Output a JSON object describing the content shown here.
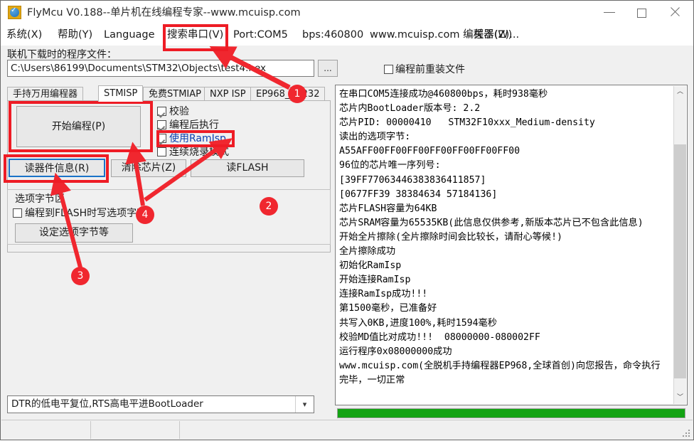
{
  "window": {
    "title": "FlyMcu V0.188--单片机在线编程专家--www.mcuisp.com",
    "icon": "app-icon",
    "minimize": "–",
    "maximize": "□",
    "close": "✕"
  },
  "menu": {
    "items": [
      {
        "text": "系统(X)",
        "name": "menu-system"
      },
      {
        "text": "帮助(Y)",
        "name": "menu-help"
      },
      {
        "text": "Language",
        "name": "menu-language"
      },
      {
        "text": "搜索串口(V)",
        "name": "menu-search-port"
      },
      {
        "text": "Port:COM5",
        "name": "menu-port"
      },
      {
        "text": "bps:460800",
        "name": "menu-bps"
      },
      {
        "text": "www.mcuisp.com 编程器(W)",
        "name": "menu-programmer"
      },
      {
        "text": "关于(Z)...",
        "name": "menu-about"
      }
    ]
  },
  "file": {
    "label": "联机下载时的程序文件：",
    "path": "C:\\Users\\86199\\Documents\\STM32\\Objects\\test4.hex",
    "browse_label": "...",
    "reload_checkbox": {
      "label": "编程前重装文件",
      "checked": false
    }
  },
  "tabs": [
    {
      "label": "手持万用编程器",
      "selected": false
    },
    {
      "label": "STMISP",
      "selected": true
    },
    {
      "label": "免费STMIAP",
      "selected": false
    },
    {
      "label": "NXP ISP",
      "selected": false
    },
    {
      "label": "EP968_RS232",
      "selected": false
    }
  ],
  "actions": {
    "start_program": "开始编程(P)",
    "read_device_info": "读器件信息(R)",
    "erase_chip": "清除芯片(Z)",
    "read_flash": "读FLASH"
  },
  "options": [
    {
      "label": "校验",
      "checked": true
    },
    {
      "label": "编程后执行",
      "checked": true
    },
    {
      "label": "使用RamIsp",
      "checked": true
    },
    {
      "label": "连续烧录模式",
      "checked": false
    }
  ],
  "option_bytes": {
    "group_title": "选项字节区",
    "write_on_flash": {
      "label": "编程到FLASH时写选项字节",
      "checked": false
    },
    "set_button": "设定选项字节等"
  },
  "log": {
    "lines": [
      "在串口COM5连接成功@460800bps，耗时938毫秒",
      "芯片内BootLoader版本号: 2.2",
      "芯片PID: 00000410   STM32F10xxx_Medium-density",
      "读出的选项字节:",
      "A55AFF00FF00FF00FF00FF00FF00FF00",
      "96位的芯片唯一序列号:",
      "[39FF77063446383836411857]",
      "[0677FF39 38384634 57184136]",
      "芯片FLASH容量为64KB",
      "芯片SRAM容量为65535KB(此信息仅供参考,新版本芯片已不包含此信息)",
      "开始全片擦除(全片擦除时间会比较长，请耐心等候!)",
      "全片擦除成功",
      "初始化RamIsp",
      "开始连接RamIsp",
      "连接RamIsp成功!!!",
      "第1500毫秒，已准备好",
      "共写入0KB,进度100%,耗时1594毫秒",
      "校验MD值比对成功!!!  08000000-080002FF",
      "运行程序0x08000000成功",
      "www.mcuisp.com(全脱机手持编程器EP968,全球首创)向您报告，命令执行完毕，一切正常"
    ],
    "scroll_up_icon": "︿",
    "scroll_down_icon": "﹀"
  },
  "bootloader_combo": {
    "value": "DTR的低电平复位,RTS高电平进BootLoader",
    "arrow_icon": "▾"
  },
  "progress": {
    "percent": 100,
    "color": "#13a313"
  },
  "status_bar": {
    "panes": [
      "",
      "",
      ""
    ]
  },
  "annotations": {
    "markers": [
      {
        "number": "1"
      },
      {
        "number": "2"
      },
      {
        "number": "3"
      },
      {
        "number": "4"
      }
    ],
    "highlight_color": "#ee1c25"
  }
}
